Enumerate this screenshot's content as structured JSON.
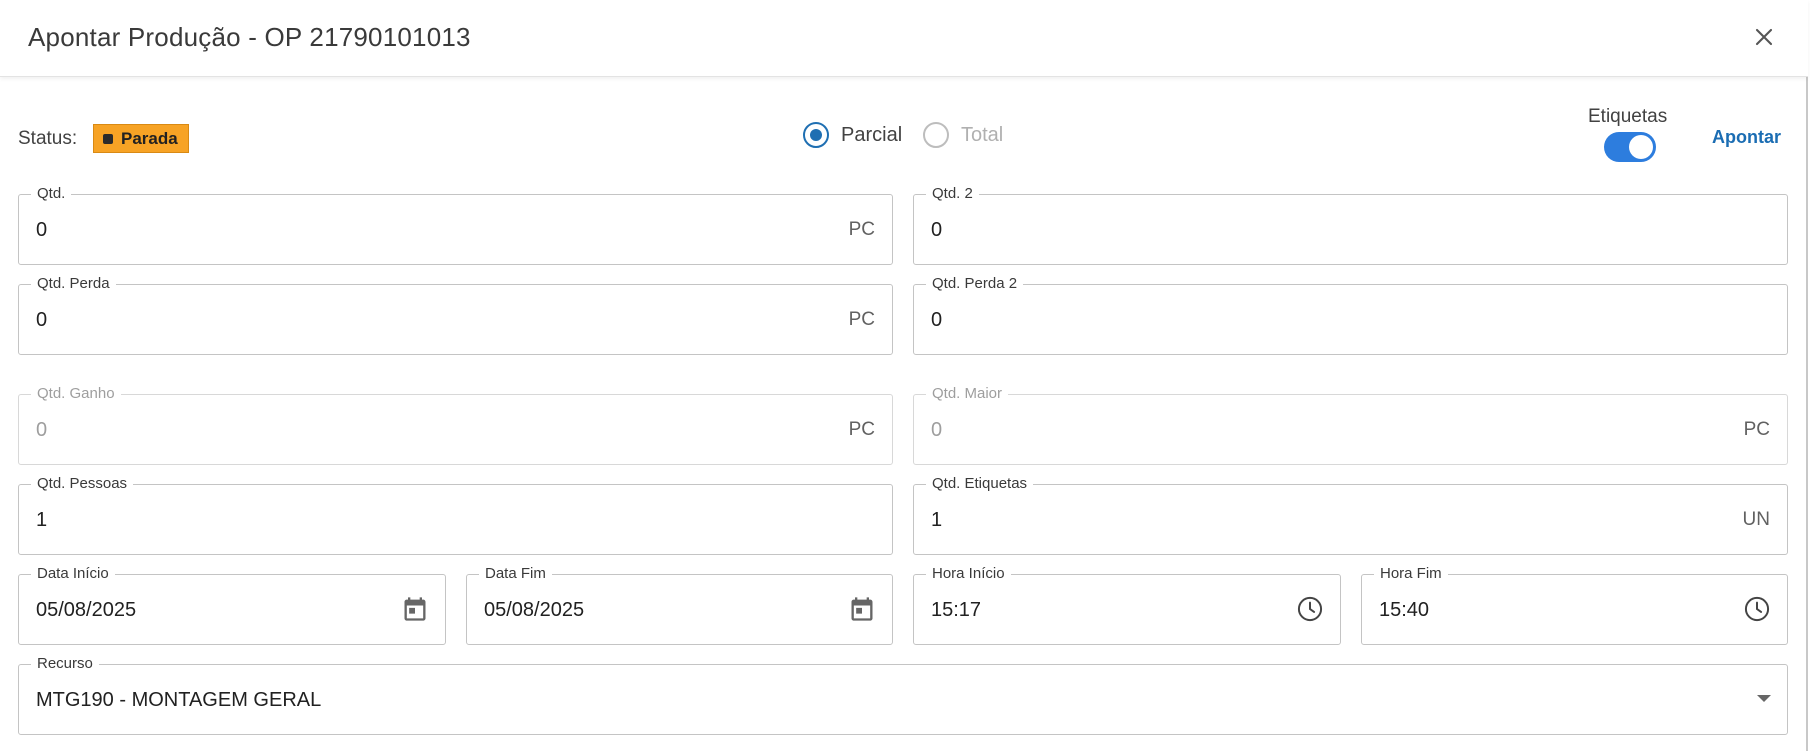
{
  "header": {
    "title": "Apontar Produção - OP 21790101013"
  },
  "status": {
    "label": "Status:",
    "badge": "Parada"
  },
  "mode": {
    "partial": "Parcial",
    "total": "Total"
  },
  "etiquetas": {
    "label": "Etiquetas",
    "enabled": true
  },
  "actions": {
    "apontar": "Apontar"
  },
  "fields": {
    "qtd": {
      "label": "Qtd.",
      "value": "0",
      "unit": "PC"
    },
    "qtd2": {
      "label": "Qtd. 2",
      "value": "0"
    },
    "qtd_perda": {
      "label": "Qtd. Perda",
      "value": "0",
      "unit": "PC"
    },
    "qtd_perda2": {
      "label": "Qtd. Perda 2",
      "value": "0"
    },
    "qtd_ganho": {
      "label": "Qtd. Ganho",
      "value": "0",
      "unit": "PC"
    },
    "qtd_maior": {
      "label": "Qtd. Maior",
      "value": "0",
      "unit": "PC"
    },
    "qtd_pessoas": {
      "label": "Qtd. Pessoas",
      "value": "1"
    },
    "qtd_etiquetas": {
      "label": "Qtd. Etiquetas",
      "value": "1",
      "unit": "UN"
    },
    "data_inicio": {
      "label": "Data Início",
      "value": "05/08/2025"
    },
    "data_fim": {
      "label": "Data Fim",
      "value": "05/08/2025"
    },
    "hora_inicio": {
      "label": "Hora Início",
      "value": "15:17"
    },
    "hora_fim": {
      "label": "Hora Fim",
      "value": "15:40"
    },
    "recurso": {
      "label": "Recurso",
      "value": "MTG190 - MONTAGEM GERAL"
    }
  },
  "colors": {
    "accent": "#1f6fb2",
    "status_badge": "#f7a325",
    "toggle_on": "#2d7dde"
  }
}
